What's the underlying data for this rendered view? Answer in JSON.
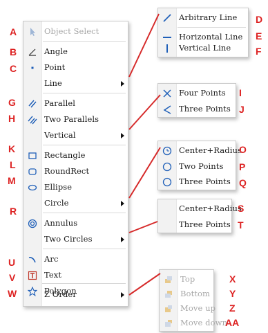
{
  "main_menu": {
    "items": [
      {
        "label": "Object Select",
        "letter": "A",
        "icon": "cursor-arrow-icon",
        "disabled": true
      },
      {
        "label": "Angle",
        "letter": "B",
        "icon": "angle-icon"
      },
      {
        "label": "Point",
        "letter": "C",
        "icon": "point-icon"
      },
      {
        "label": "Line",
        "letter": "",
        "icon": "",
        "submenu": true
      },
      {
        "label": "Parallel",
        "letter": "G",
        "icon": "parallel-lines-icon"
      },
      {
        "label": "Two Parallels",
        "letter": "H",
        "icon": "two-parallels-icon"
      },
      {
        "label": "Vertical",
        "letter": "",
        "icon": "",
        "submenu": true
      },
      {
        "label": "Rectangle",
        "letter": "K",
        "icon": "rectangle-icon"
      },
      {
        "label": "RoundRect",
        "letter": "L",
        "icon": "rounded-rectangle-icon"
      },
      {
        "label": "Ellipse",
        "letter": "M",
        "icon": "ellipse-icon"
      },
      {
        "label": "Circle",
        "letter": "",
        "icon": "",
        "submenu": true
      },
      {
        "label": "Annulus",
        "letter": "R",
        "icon": "annulus-icon"
      },
      {
        "label": "Two Circles",
        "letter": "",
        "icon": "",
        "submenu": true
      },
      {
        "label": "Arc",
        "letter": "U",
        "icon": "arc-icon"
      },
      {
        "label": "Text",
        "letter": "V",
        "icon": "text-icon"
      },
      {
        "label": "Polygon",
        "letter": "W",
        "icon": "polygon-star-icon"
      },
      {
        "label": "Z Order",
        "letter": "",
        "icon": "",
        "submenu": true
      }
    ]
  },
  "line_submenu": {
    "items": [
      {
        "label": "Arbitrary Line",
        "letter": "D",
        "icon": "arbitrary-line-icon"
      },
      {
        "label": "Horizontal Line",
        "letter": "E",
        "icon": "horizontal-line-icon"
      },
      {
        "label": "Vertical Line",
        "letter": "F",
        "icon": "vertical-line-icon"
      }
    ]
  },
  "vertical_submenu": {
    "items": [
      {
        "label": "Four Points",
        "letter": "I",
        "icon": "four-points-icon"
      },
      {
        "label": "Three Points",
        "letter": "J",
        "icon": "three-points-icon"
      }
    ]
  },
  "circle_submenu": {
    "items": [
      {
        "label": "Center+Radius",
        "letter": "O",
        "icon": "circle-center-icon"
      },
      {
        "label": "Two Points",
        "letter": "P",
        "icon": "circle-icon"
      },
      {
        "label": "Three Points",
        "letter": "Q",
        "icon": "circle-icon"
      }
    ]
  },
  "two_circles_submenu": {
    "items": [
      {
        "label": "Center+Radius",
        "letter": "S"
      },
      {
        "label": "Three Points",
        "letter": "T"
      }
    ]
  },
  "z_order_submenu": {
    "items": [
      {
        "label": "Top",
        "letter": "X",
        "icon": "bring-to-top-icon",
        "disabled": true
      },
      {
        "label": "Bottom",
        "letter": "Y",
        "icon": "send-to-bottom-icon",
        "disabled": true
      },
      {
        "label": "Move up",
        "letter": "Z",
        "icon": "move-up-icon",
        "disabled": true
      },
      {
        "label": "Move down",
        "letter": "AA",
        "icon": "move-down-icon",
        "disabled": true
      }
    ]
  },
  "colors": {
    "annotation": "#dd2222",
    "icon_blue": "#1f5fb8",
    "disabled_text": "#a7a7a7"
  }
}
